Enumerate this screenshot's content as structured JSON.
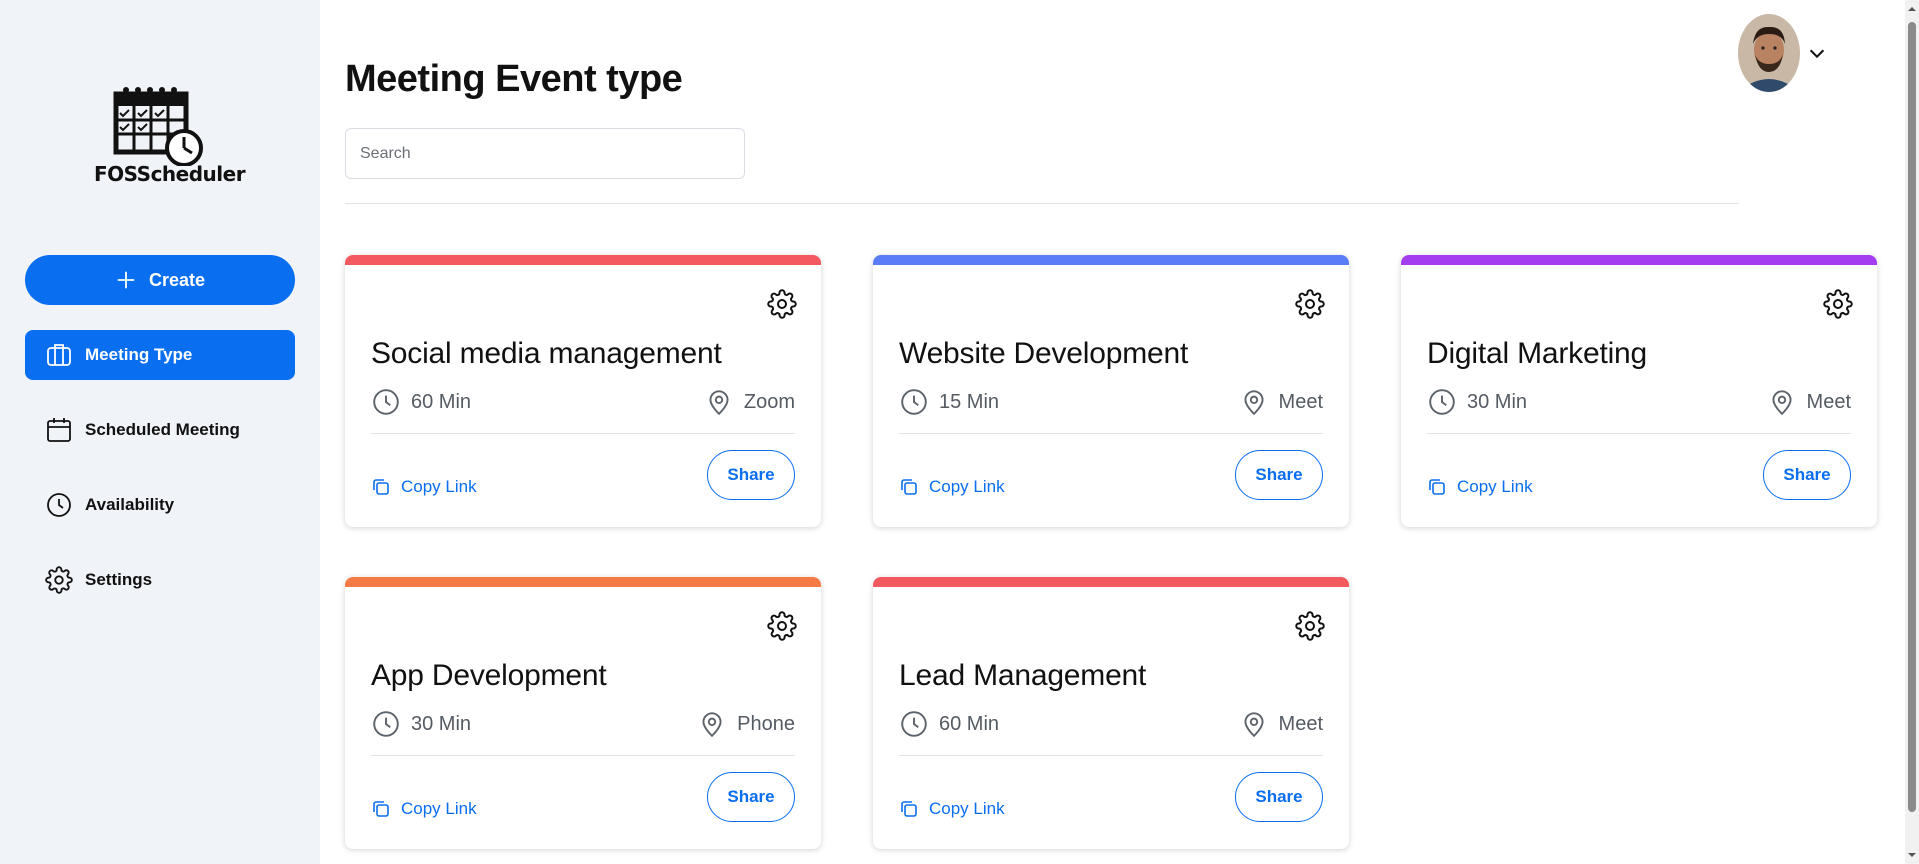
{
  "app": {
    "logo_text": "FOSScheduler"
  },
  "sidebar": {
    "create_label": "Create",
    "items": [
      {
        "label": "Meeting Type",
        "icon": "briefcase-icon",
        "active": true
      },
      {
        "label": "Scheduled Meeting",
        "icon": "calendar-icon",
        "active": false
      },
      {
        "label": "Availability",
        "icon": "clock-icon",
        "active": false
      },
      {
        "label": "Settings",
        "icon": "gear-icon",
        "active": false
      }
    ]
  },
  "header": {
    "title": "Meeting Event type",
    "search_placeholder": "Search"
  },
  "cards": [
    {
      "title": "Social media management",
      "duration": "60 Min",
      "location": "Zoom",
      "color": "#f25a5f",
      "copy_label": "Copy Link",
      "share_label": "Share"
    },
    {
      "title": "Website Development",
      "duration": "15 Min",
      "location": "Meet",
      "color": "#5b7cf7",
      "copy_label": "Copy Link",
      "share_label": "Share"
    },
    {
      "title": "Digital Marketing",
      "duration": "30 Min",
      "location": "Meet",
      "color": "#a43cf0",
      "copy_label": "Copy Link",
      "share_label": "Share"
    },
    {
      "title": "App Development",
      "duration": "30 Min",
      "location": "Phone",
      "color": "#f57a45",
      "copy_label": "Copy Link",
      "share_label": "Share"
    },
    {
      "title": "Lead Management",
      "duration": "60 Min",
      "location": "Meet",
      "color": "#f25a5f",
      "copy_label": "Copy Link",
      "share_label": "Share"
    }
  ],
  "colors": {
    "accent": "#0a6ef0",
    "sidebar_bg": "#f0f3f8"
  }
}
